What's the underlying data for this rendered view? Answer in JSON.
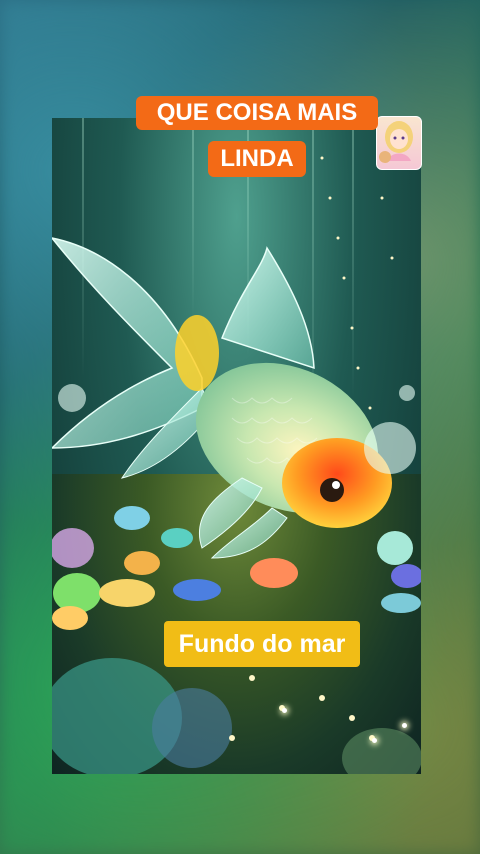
{
  "caption_top_line1": "QUE COISA MAIS",
  "caption_top_line2": "LINDA",
  "caption_bottom": "Fundo do mar",
  "colors": {
    "caption_top_bg": "#f36a16",
    "caption_bottom_bg": "#f1bd16"
  }
}
